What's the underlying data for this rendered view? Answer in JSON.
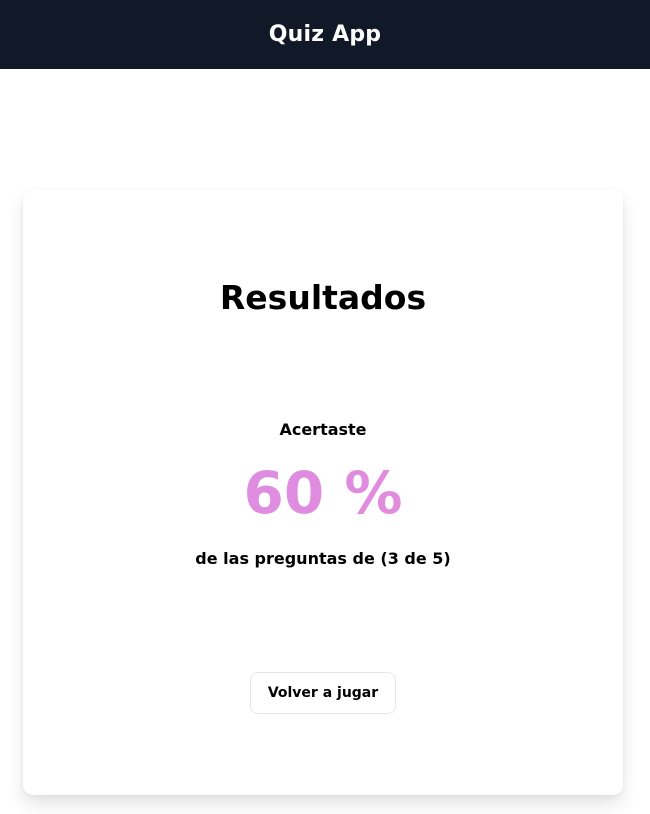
{
  "header": {
    "title": "Quiz App",
    "background": "#111827"
  },
  "results": {
    "title": "Resultados",
    "intro": "Acertaste",
    "percentage": "60 %",
    "score_fraction": 0.6,
    "correct": 3,
    "total": 5,
    "detail": "de las preguntas de (3 de 5)",
    "accent_colors": [
      "#d78ee8",
      "#e88bd6"
    ]
  },
  "actions": {
    "replay_label": "Volver a jugar"
  }
}
